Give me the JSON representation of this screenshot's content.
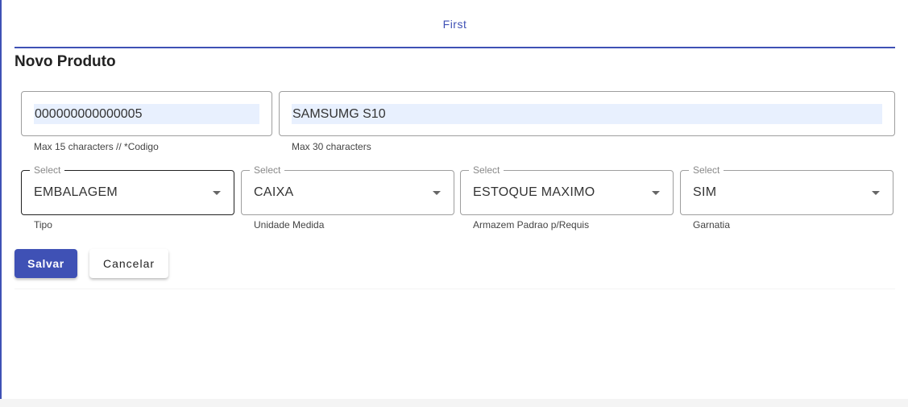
{
  "tabs": [
    {
      "label": "First",
      "active": true
    }
  ],
  "form": {
    "title": "Novo Produto",
    "codigo": {
      "value": "000000000000005",
      "hint": "Max 15 characters // *Codigo"
    },
    "descricao": {
      "value": "SAMSUMG S10",
      "hint": "Max 30 characters"
    },
    "selects": [
      {
        "label": "Select",
        "value": "EMBALAGEM",
        "hint": "Tipo"
      },
      {
        "label": "Select",
        "value": "CAIXA",
        "hint": "Unidade Medida"
      },
      {
        "label": "Select",
        "value": "ESTOQUE MAXIMO",
        "hint": "Armazem Padrao p/Requis"
      },
      {
        "label": "Select",
        "value": "SIM",
        "hint": "Garnatia"
      }
    ],
    "save_label": "Salvar",
    "cancel_label": "Cancelar"
  },
  "colors": {
    "primary": "#3f51b5",
    "autofill": "#e8f0fe"
  }
}
